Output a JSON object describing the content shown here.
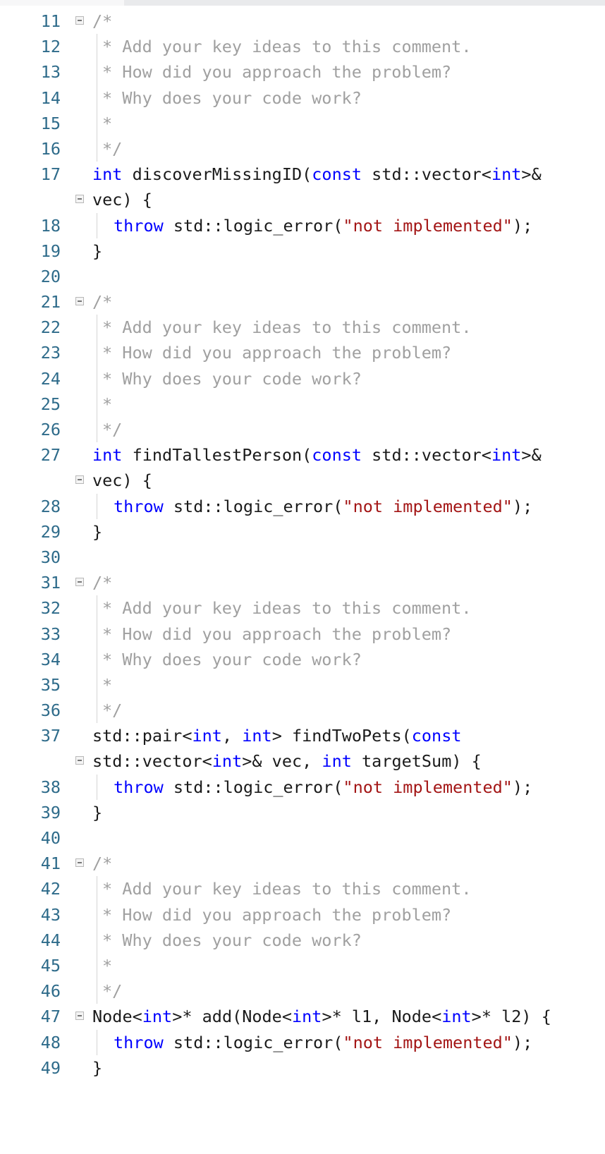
{
  "editor": {
    "comment": {
      "open": "/*",
      "line1": "* Add your key ideas to this comment.",
      "line2": "* How did you approach the problem?",
      "line3": "* Why does your code work?",
      "line4": "*",
      "close": "*/"
    },
    "throw_kw": "throw",
    "throw_call": " std::logic_error(",
    "throw_msg": "\"not implemented\"",
    "throw_end": ");",
    "close_brace": "}",
    "functions": [
      {
        "lines": [
          "11",
          "12",
          "13",
          "14",
          "15",
          "16",
          "17",
          "18",
          "19",
          "20"
        ],
        "sig_a": {
          "kw1": "int",
          " name": " discoverMissingID(",
          "kw2": "const",
          "t1": " std::vector<",
          "kw3": "int",
          "t2": ">&"
        },
        "sig_b": "vec) {"
      },
      {
        "lines": [
          "21",
          "22",
          "23",
          "24",
          "25",
          "26",
          "27",
          "28",
          "29",
          "30"
        ],
        "sig_a": {
          "kw1": "int",
          " name": " findTallestPerson(",
          "kw2": "const",
          "t1": " std::vector<",
          "kw3": "int",
          "t2": ">&"
        },
        "sig_b": "vec) {"
      },
      {
        "lines": [
          "31",
          "32",
          "33",
          "34",
          "35",
          "36",
          "37",
          "38",
          "39",
          "40"
        ],
        "sig_a": {
          "t0": "std::pair<",
          "kw1": "int",
          "t1": ", ",
          "kw2": "int",
          "t2": "> findTwoPets(",
          "kw3": "const"
        },
        "sig_b": {
          "t0": "std::vector<",
          "kw1": "int",
          "t1": ">& vec, ",
          "kw2": "int",
          "t2": " targetSum) {"
        }
      },
      {
        "lines": [
          "41",
          "42",
          "43",
          "44",
          "45",
          "46",
          "47",
          "48",
          "49"
        ],
        "sig": {
          "t0": "Node<",
          "kw1": "int",
          "t1": ">* add(Node<",
          "kw2": "int",
          "t2": ">* l1, Node<",
          "kw3": "int",
          "t3": ">* l2) {"
        }
      }
    ]
  }
}
